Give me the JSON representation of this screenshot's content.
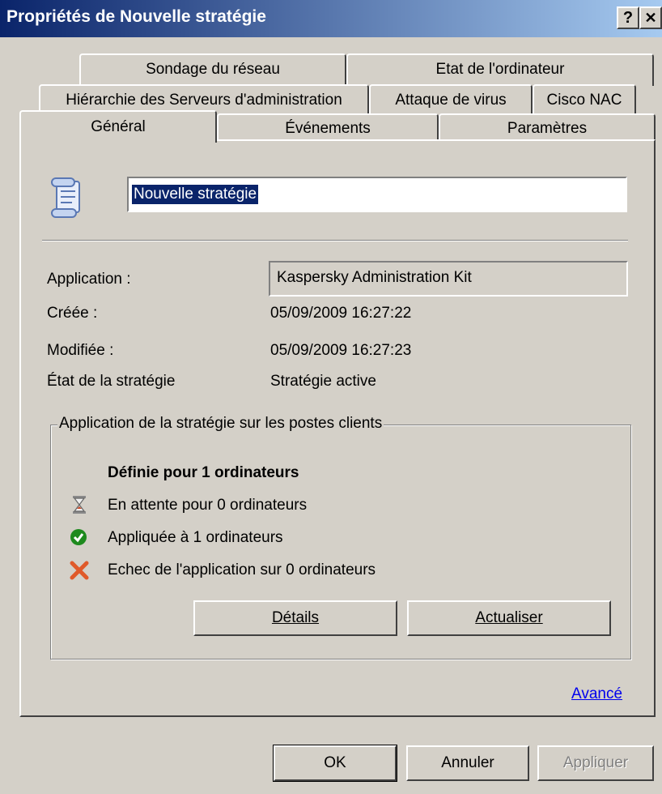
{
  "window": {
    "title": "Propriétés de Nouvelle stratégie",
    "help_btn": "?",
    "close_btn": "✕"
  },
  "tabs": {
    "row1": [
      "Sondage du réseau",
      "Etat de l'ordinateur"
    ],
    "row2": [
      "Hiérarchie des Serveurs d'administration",
      "Attaque de virus",
      "Cisco NAC"
    ],
    "row3": [
      "Général",
      "Événements",
      "Paramètres"
    ],
    "selected": "Général"
  },
  "general": {
    "icon": "policy-scroll-icon",
    "policy_name": "Nouvelle stratégie",
    "application_label": "Application :",
    "application_value": "Kaspersky Administration Kit",
    "created_label": "Créée :",
    "created_value": "05/09/2009 16:27:22",
    "modified_label": "Modifiée :",
    "modified_value": "05/09/2009 16:27:23",
    "state_label": "État de la stratégie",
    "state_value": "Stratégie active"
  },
  "deployment": {
    "group_title": "Application de la stratégie sur les postes clients",
    "defined": "Définie pour 1 ordinateurs",
    "pending": "En attente pour 0 ordinateurs",
    "applied": "Appliquée à 1 ordinateurs",
    "failed": "Echec de l'application sur 0 ordinateurs",
    "details_button": "Détails",
    "refresh_button": "Actualiser"
  },
  "advanced_link": "Avancé",
  "footer": {
    "ok": "OK",
    "cancel": "Annuler",
    "apply": "Appliquer"
  },
  "colors": {
    "title_bar": "#0a246a",
    "window_bg": "#d4d0c8",
    "link": "#0000ee",
    "success": "#1e8a1e",
    "error": "#e05a2a"
  }
}
